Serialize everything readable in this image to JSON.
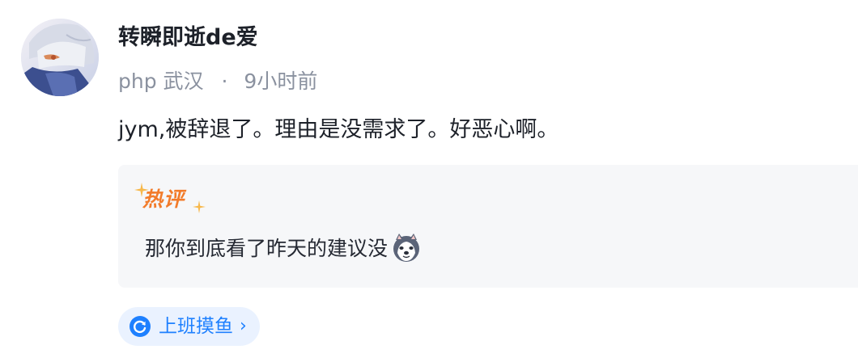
{
  "author": {
    "name": "转瞬即逝de爱",
    "avatar_icon": "anime-avatar"
  },
  "meta": {
    "job": "php",
    "location": "武汉",
    "separator": "·",
    "time": "9小时前"
  },
  "content": "jym,被辞退了。理由是没需求了。好恶心啊。",
  "hot_comment": {
    "label": "热评",
    "text": "那你到底看了昨天的建议没",
    "emoji_icon": "husky-dog-emoji"
  },
  "topic_tag": {
    "label": "上班摸鱼",
    "icon": "refresh-circle-icon",
    "chevron": "›"
  },
  "colors": {
    "text_primary": "#1d2129",
    "text_secondary": "#8a919f",
    "hot_label": "#f27b2a",
    "tag_accent": "#1e80ff",
    "tag_bg": "#eaf2ff",
    "comment_bg": "#f6f7f9"
  }
}
